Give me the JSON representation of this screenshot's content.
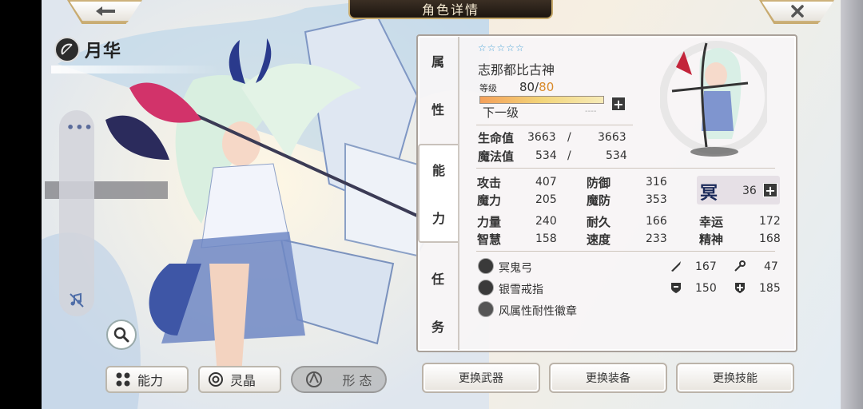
{
  "header": {
    "title": "角色详情"
  },
  "character": {
    "name": "月华",
    "stars": "☆☆☆☆☆",
    "fullname": "志那都比古神",
    "level_label": "等级",
    "level": "80",
    "level_sep": "/",
    "level_max": "80",
    "next_level_label": "下一级",
    "next_level_value": "----"
  },
  "tabs": [
    {
      "chars": [
        "属",
        "性"
      ]
    },
    {
      "chars": [
        "能",
        "力"
      ]
    },
    {
      "chars": [
        "任",
        "务"
      ]
    }
  ],
  "vitals": {
    "hp_label": "生命值",
    "hp": "3663",
    "hp_sep": "/",
    "hp_max": "3663",
    "mp_label": "魔法值",
    "mp": "534",
    "mp_sep": "/",
    "mp_max": "534"
  },
  "stats": {
    "atk_label": "攻击",
    "atk": "407",
    "def_label": "防御",
    "def": "316",
    "mag_label": "魔力",
    "mag": "205",
    "mdef_label": "魔防",
    "mdef": "353",
    "str_label": "力量",
    "str": "240",
    "end_label": "耐久",
    "end": "166",
    "luck_label": "幸运",
    "luck": "172",
    "wis_label": "智慧",
    "wis": "158",
    "spd_label": "速度",
    "spd": "233",
    "spi_label": "精神",
    "spi": "168",
    "special_icon": "冥",
    "special_value": "36"
  },
  "equipment": {
    "weapon": "冥鬼弓",
    "ring": "银雪戒指",
    "badge": "风属性耐性徽章"
  },
  "equip_stats": {
    "sword": "167",
    "staff": "47",
    "shield": "150",
    "cross": "185"
  },
  "left_buttons": {
    "ability": "能力",
    "crystal": "灵晶",
    "form": "形 态"
  },
  "right_buttons": {
    "weapon": "更换武器",
    "gear": "更换装备",
    "skill": "更换技能"
  },
  "colors": {
    "star": "#4fa6d8",
    "level_max": "#d98a2a",
    "title_bar": "#2a2018"
  }
}
